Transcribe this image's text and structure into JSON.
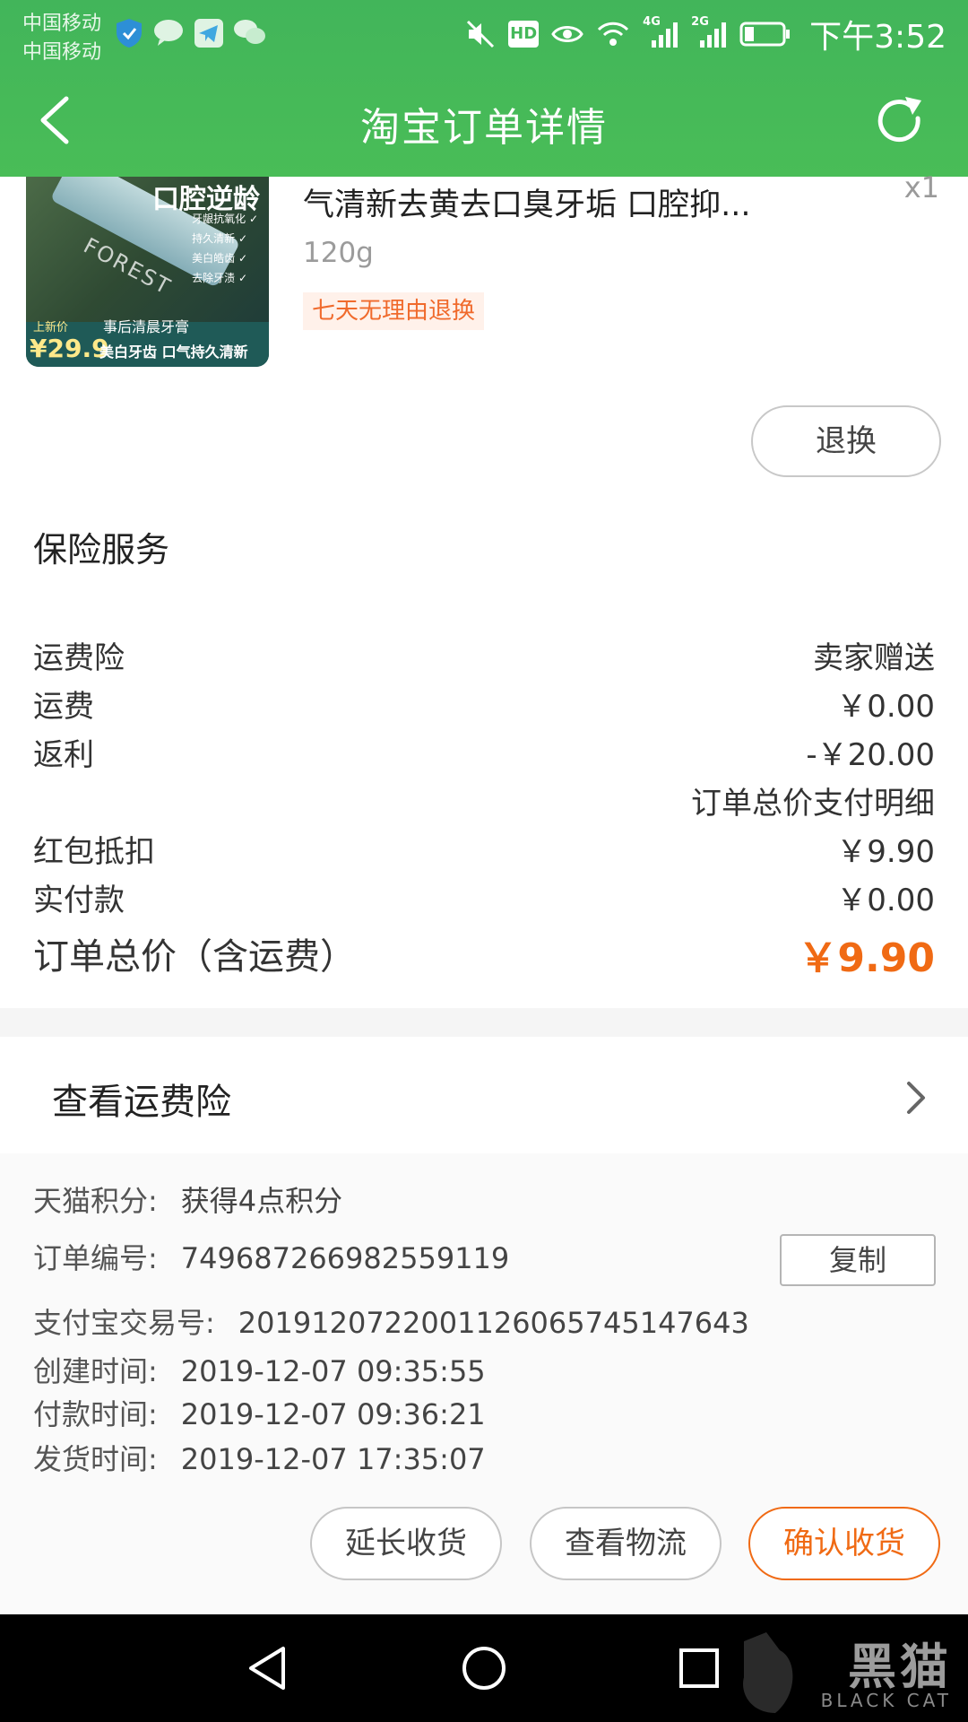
{
  "status_bar": {
    "carrier_1": "中国移动",
    "carrier_2": "中国移动",
    "network_1": "4G",
    "network_2": "2G",
    "time": "下午3:52",
    "hd_badge": "HD",
    "icons_left": [
      "shield-app-icon",
      "message-app-icon",
      "telegram-icon",
      "wechat-icon"
    ],
    "icons_right": [
      "mute-icon",
      "hd-icon",
      "eye-icon",
      "wifi-icon",
      "signal-4g-icon",
      "signal-2g-icon",
      "battery-icon"
    ]
  },
  "header": {
    "title": "淘宝订单详情",
    "background": "#44b85a"
  },
  "product": {
    "title": "气清新去黄去口臭牙垢 口腔抑...",
    "quantity": "x1",
    "spec": "120g",
    "return_tag": "七天无理由退换",
    "exchange_label": "退换",
    "image": {
      "top_text": "口腔逆龄",
      "features": [
        "牙龈抗氧化 ✓",
        "持久清新 ✓",
        "美白皓齿 ✓",
        "去除牙渍 ✓"
      ],
      "sub_text": "事后清晨牙膏",
      "slogan": "美白牙齿 口气持久清新",
      "price_label": "上新价",
      "price": "¥29.9",
      "logo": "FOREST"
    }
  },
  "insurance": {
    "title": "保险服务"
  },
  "price_rows": {
    "freight_insurance": {
      "label": "运费险",
      "value": "卖家赠送"
    },
    "freight": {
      "label": "运费",
      "value": "￥0.00"
    },
    "rebate": {
      "label": "返利",
      "value": "-￥20.00"
    },
    "payment_detail": {
      "label": "",
      "value": "订单总价支付明细"
    },
    "red_packet": {
      "label": "红包抵扣",
      "value": "￥9.90"
    },
    "paid": {
      "label": "实付款",
      "value": "￥0.00"
    },
    "total": {
      "label": "订单总价（含运费）",
      "value": "￥9.90"
    }
  },
  "view_insurance": {
    "label": "查看运费险"
  },
  "order_info": {
    "points": {
      "key": "天猫积分:",
      "value": "获得4点积分"
    },
    "order_no": {
      "key": "订单编号:",
      "value": "749687266982559119"
    },
    "alipay_no": {
      "key": "支付宝交易号:",
      "value": "2019120722001126065745147643"
    },
    "created": {
      "key": "创建时间:",
      "value": "2019-12-07 09:35:55"
    },
    "paid_time": {
      "key": "付款时间:",
      "value": "2019-12-07 09:36:21"
    },
    "shipped": {
      "key": "发货时间:",
      "value": "2019-12-07 17:35:07"
    },
    "copy_label": "复制"
  },
  "actions": {
    "extend": "延长收货",
    "logistics": "查看物流",
    "confirm": "确认收货",
    "accent_color": "#f06a14"
  },
  "watermark": {
    "text": "黑猫",
    "sub": "BLACK CAT"
  }
}
